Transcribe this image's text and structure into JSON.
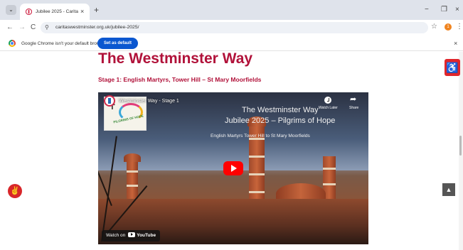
{
  "browser": {
    "tab_title": "Jubilee 2025 - Caritas Westminster",
    "tab_close": "×",
    "new_tab": "+",
    "tab_search": "⌄",
    "minimize": "−",
    "restore": "❐",
    "close": "×",
    "back": "←",
    "forward": "→",
    "reload": "C",
    "site_info": "⚲",
    "url": "caritaswestminster.org.uk/jubilee-2025/",
    "bookmark_star": "☆",
    "profile_initial": "1",
    "menu": "⋮"
  },
  "infobar": {
    "message": "Google Chrome isn't your default browser",
    "button_label": "Set as default",
    "close": "×"
  },
  "page": {
    "title": "The Westminster Way",
    "stage_heading": "Stage 1: English Martyrs, Tower Hill – St Mary Moorfields"
  },
  "video": {
    "title": "Westminster Way - Stage 1",
    "overlay_line1": "The Westminster Way",
    "overlay_line2": "Jubilee 2025 – Pilgrims of Hope",
    "overlay_line3": "English Martyrs Tower Hill to St Mary Moorfields",
    "logo_text": "PILGRIMS OF HOPE",
    "watch_later": "Watch Later",
    "share": "Share",
    "watch_on": "Watch on",
    "youtube": "YouTube"
  },
  "widgets": {
    "accessibility": "♿",
    "scroll_top": "▲",
    "fab": "✌"
  },
  "colors": {
    "accent": "#b1123a",
    "chrome_blue": "#0b57d0",
    "youtube_red": "#ff0000"
  }
}
